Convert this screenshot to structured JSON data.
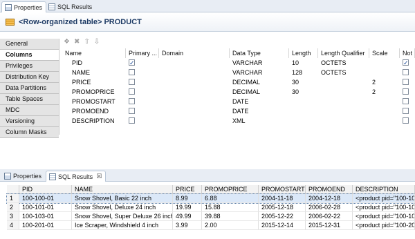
{
  "top_tabs": {
    "properties": "Properties",
    "sql_results": "SQL Results"
  },
  "header": {
    "title": "<Row-organized table> PRODUCT"
  },
  "sidebar": {
    "items": [
      "General",
      "Columns",
      "Privileges",
      "Distribution Key",
      "Data Partitions",
      "Table Spaces",
      "MDC",
      "Versioning",
      "Column Masks"
    ],
    "active": "Columns"
  },
  "columns_grid": {
    "headers": [
      "Name",
      "Primary ...",
      "Domain",
      "Data Type",
      "Length",
      "Length Qualifier",
      "Scale",
      "Not"
    ],
    "rows": [
      {
        "name": "PID",
        "primary": true,
        "domain": "",
        "type": "VARCHAR",
        "length": "10",
        "qualifier": "OCTETS",
        "scale": "",
        "not_null": true
      },
      {
        "name": "NAME",
        "primary": false,
        "domain": "",
        "type": "VARCHAR",
        "length": "128",
        "qualifier": "OCTETS",
        "scale": "",
        "not_null": false
      },
      {
        "name": "PRICE",
        "primary": false,
        "domain": "",
        "type": "DECIMAL",
        "length": "30",
        "qualifier": "",
        "scale": "2",
        "not_null": false
      },
      {
        "name": "PROMOPRICE",
        "primary": false,
        "domain": "",
        "type": "DECIMAL",
        "length": "30",
        "qualifier": "",
        "scale": "2",
        "not_null": false
      },
      {
        "name": "PROMOSTART",
        "primary": false,
        "domain": "",
        "type": "DATE",
        "length": "",
        "qualifier": "",
        "scale": "",
        "not_null": false
      },
      {
        "name": "PROMOEND",
        "primary": false,
        "domain": "",
        "type": "DATE",
        "length": "",
        "qualifier": "",
        "scale": "",
        "not_null": false
      },
      {
        "name": "DESCRIPTION",
        "primary": false,
        "domain": "",
        "type": "XML",
        "length": "",
        "qualifier": "",
        "scale": "",
        "not_null": false
      }
    ]
  },
  "bottom_tabs": {
    "properties": "Properties",
    "sql_results": "SQL Results",
    "close": "☒"
  },
  "results": {
    "headers": [
      "PID",
      "NAME",
      "PRICE",
      "PROMOPRICE",
      "PROMOSTART",
      "PROMOEND",
      "DESCRIPTION"
    ],
    "rows": [
      {
        "n": "1",
        "cells": [
          "100-100-01",
          "Snow Shovel, Basic 22 inch",
          "8.99",
          "6.88",
          "2004-11-18",
          "2004-12-18",
          "<product pid=\"100-10"
        ]
      },
      {
        "n": "2",
        "cells": [
          "100-101-01",
          "Snow Shovel, Deluxe 24 inch",
          "19.99",
          "15.88",
          "2005-12-18",
          "2006-02-28",
          "<product pid=\"100-10"
        ]
      },
      {
        "n": "3",
        "cells": [
          "100-103-01",
          "Snow Shovel, Super Deluxe 26 inch",
          "49.99",
          "39.88",
          "2005-12-22",
          "2006-02-22",
          "<product pid=\"100-10"
        ]
      },
      {
        "n": "4",
        "cells": [
          "100-201-01",
          "Ice Scraper, Windshield 4 inch",
          "3.99",
          "2.00",
          "2015-12-14",
          "2015-12-31",
          "<product pid=\"100-20"
        ]
      }
    ],
    "selected_row": 1
  }
}
